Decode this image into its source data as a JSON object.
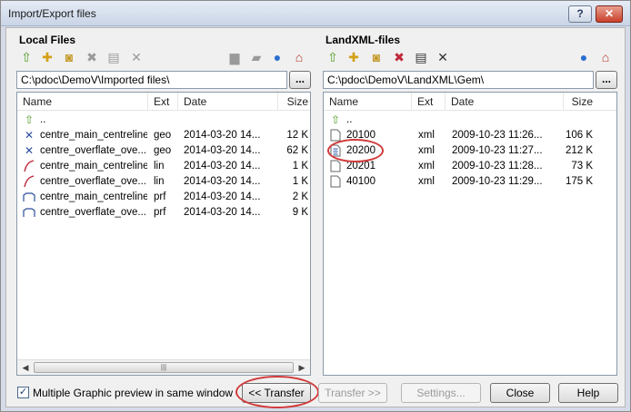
{
  "window": {
    "title": "Import/Export files",
    "help_glyph": "?",
    "close_glyph": "✕"
  },
  "local": {
    "title": "Local Files",
    "path": "C:\\pdoc\\DemoV\\Imported files\\",
    "browse_label": "...",
    "columns": [
      "Name",
      "Ext",
      "Date",
      "Size"
    ],
    "rows": [
      {
        "name": "..",
        "ext": "",
        "date": "",
        "size": "",
        "icon": "up-folder-icon"
      },
      {
        "name": "centre_main_centreline",
        "ext": "geo",
        "date": "2014-03-20 14...",
        "size": "12 K",
        "icon": "geometry-file-icon"
      },
      {
        "name": "centre_overflate_ove...",
        "ext": "geo",
        "date": "2014-03-20 14...",
        "size": "62 K",
        "icon": "geometry-file-icon"
      },
      {
        "name": "centre_main_centreline",
        "ext": "lin",
        "date": "2014-03-20 14...",
        "size": "1 K",
        "icon": "line-file-icon"
      },
      {
        "name": "centre_overflate_ove...",
        "ext": "lin",
        "date": "2014-03-20 14...",
        "size": "1 K",
        "icon": "line-file-icon"
      },
      {
        "name": "centre_main_centreline",
        "ext": "prf",
        "date": "2014-03-20 14...",
        "size": "2 K",
        "icon": "profile-file-icon"
      },
      {
        "name": "centre_overflate_ove...",
        "ext": "prf",
        "date": "2014-03-20 14...",
        "size": "9 K",
        "icon": "profile-file-icon"
      }
    ]
  },
  "landxml": {
    "title": "LandXML-files",
    "path": "C:\\pdoc\\DemoV\\LandXML\\Gem\\",
    "browse_label": "...",
    "columns": [
      "Name",
      "Ext",
      "Date",
      "Size"
    ],
    "rows": [
      {
        "name": "..",
        "ext": "",
        "date": "",
        "size": "",
        "icon": "up-folder-icon"
      },
      {
        "name": "20100",
        "ext": "xml",
        "date": "2009-10-23 11:26...",
        "size": "106 K",
        "icon": "document-icon"
      },
      {
        "name": "20200",
        "ext": "xml",
        "date": "2009-10-23 11:27...",
        "size": "212 K",
        "icon": "document-grid-icon"
      },
      {
        "name": "20201",
        "ext": "xml",
        "date": "2009-10-23 11:28...",
        "size": "73 K",
        "icon": "document-icon"
      },
      {
        "name": "40100",
        "ext": "xml",
        "date": "2009-10-23 11:29...",
        "size": "175 K",
        "icon": "document-icon"
      }
    ]
  },
  "footer": {
    "checkbox_label": "Multiple Graphic preview in same window",
    "checkbox_checked": true,
    "transfer_left": "<< Transfer",
    "transfer_right": "Transfer >>",
    "settings": "Settings...",
    "close": "Close",
    "help": "Help"
  },
  "icons": {
    "up": "⇧",
    "new_folder": "✚",
    "camera": "◙",
    "delete": "✖",
    "document": "▤",
    "measure": "✕",
    "folder": "▆",
    "folder_open": "▰",
    "globe": "●",
    "home": "⌂",
    "check": "✓",
    "scroll_left": "◀",
    "scroll_right": "▶",
    "scroll_grip": "|||"
  },
  "colors": {
    "accent_red": "#d13a3a",
    "globe_blue": "#2a6fd0",
    "home_red": "#b8322a",
    "up_green": "#4f9a1e",
    "delete_gray": "#8a8a8a"
  }
}
